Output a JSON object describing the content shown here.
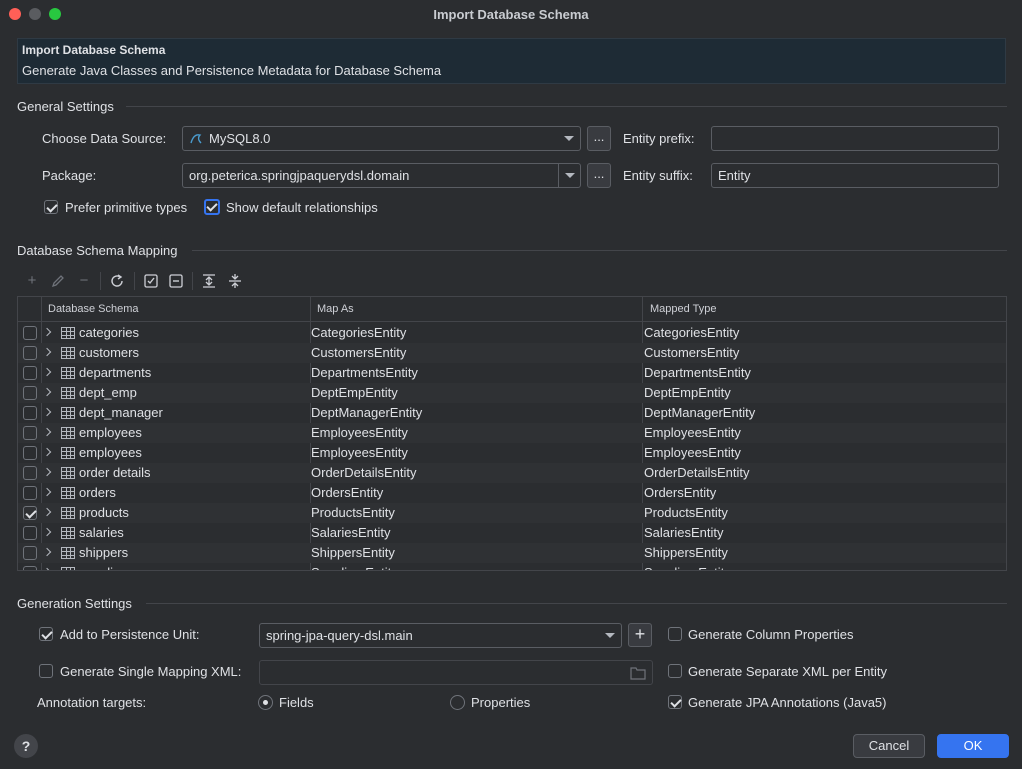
{
  "window": {
    "title": "Import Database Schema"
  },
  "banner": {
    "title": "Import Database Schema",
    "subtitle": "Generate Java Classes and Persistence Metadata for Database Schema"
  },
  "general": {
    "header": "General Settings",
    "data_source_label": "Choose Data Source:",
    "data_source_value": "MySQL8.0",
    "package_label": "Package:",
    "package_value": "org.peterica.springjpaquerydsl.domain",
    "browse_label": "...",
    "entity_prefix_label": "Entity prefix:",
    "entity_prefix_value": "",
    "entity_suffix_label": "Entity suffix:",
    "entity_suffix_value": "Entity",
    "prefer_primitive_label": "Prefer primitive types",
    "prefer_primitive_checked": true,
    "show_default_rel_label": "Show default relationships",
    "show_default_rel_checked": true
  },
  "mapping": {
    "header": "Database Schema Mapping",
    "toolbar": {
      "add_icon": "plus-icon",
      "edit_icon": "pencil-icon",
      "remove_icon": "minus-icon",
      "refresh_icon": "refresh-icon",
      "check_all_icon": "check-all-icon",
      "uncheck_all_icon": "uncheck-all-icon",
      "expand_all_icon": "expand-all-icon",
      "collapse_all_icon": "collapse-all-icon"
    },
    "columns": [
      "Database Schema",
      "Map As",
      "Mapped Type"
    ],
    "rows": [
      {
        "checked": false,
        "schema": "categories",
        "map_as": "CategoriesEntity",
        "mapped_type": "CategoriesEntity"
      },
      {
        "checked": false,
        "schema": "customers",
        "map_as": "CustomersEntity",
        "mapped_type": "CustomersEntity"
      },
      {
        "checked": false,
        "schema": "departments",
        "map_as": "DepartmentsEntity",
        "mapped_type": "DepartmentsEntity"
      },
      {
        "checked": false,
        "schema": "dept_emp",
        "map_as": "DeptEmpEntity",
        "mapped_type": "DeptEmpEntity"
      },
      {
        "checked": false,
        "schema": "dept_manager",
        "map_as": "DeptManagerEntity",
        "mapped_type": "DeptManagerEntity"
      },
      {
        "checked": false,
        "schema": "employees",
        "map_as": "EmployeesEntity",
        "mapped_type": "EmployeesEntity"
      },
      {
        "checked": false,
        "schema": "employees",
        "map_as": "EmployeesEntity",
        "mapped_type": "EmployeesEntity"
      },
      {
        "checked": false,
        "schema": "order details",
        "map_as": "OrderDetailsEntity",
        "mapped_type": "OrderDetailsEntity"
      },
      {
        "checked": false,
        "schema": "orders",
        "map_as": "OrdersEntity",
        "mapped_type": "OrdersEntity"
      },
      {
        "checked": true,
        "schema": "products",
        "map_as": "ProductsEntity",
        "mapped_type": "ProductsEntity"
      },
      {
        "checked": false,
        "schema": "salaries",
        "map_as": "SalariesEntity",
        "mapped_type": "SalariesEntity"
      },
      {
        "checked": false,
        "schema": "shippers",
        "map_as": "ShippersEntity",
        "mapped_type": "ShippersEntity"
      },
      {
        "checked": false,
        "schema": "suppliers",
        "map_as": "SuppliersEntity",
        "mapped_type": "SuppliersEntity"
      }
    ]
  },
  "generation": {
    "header": "Generation Settings",
    "add_to_pu_label": "Add to Persistence Unit:",
    "add_to_pu_checked": true,
    "persistence_unit_value": "spring-jpa-query-dsl.main",
    "single_mapping_label": "Generate Single Mapping XML:",
    "single_mapping_checked": false,
    "single_mapping_value": "",
    "annotation_targets_label": "Annotation targets:",
    "fields_label": "Fields",
    "fields_selected": true,
    "properties_label": "Properties",
    "properties_selected": false,
    "gen_column_props_label": "Generate Column Properties",
    "gen_column_props_checked": false,
    "gen_separate_xml_label": "Generate Separate XML per Entity",
    "gen_separate_xml_checked": false,
    "gen_jpa_annotations_label": "Generate JPA Annotations (Java5)",
    "gen_jpa_annotations_checked": true
  },
  "footer": {
    "help_label": "?",
    "cancel_label": "Cancel",
    "ok_label": "OK"
  },
  "colors": {
    "background": "#2b2d30",
    "accent": "#3574f0",
    "banner": "#1e2b35",
    "border": "#43454a"
  }
}
